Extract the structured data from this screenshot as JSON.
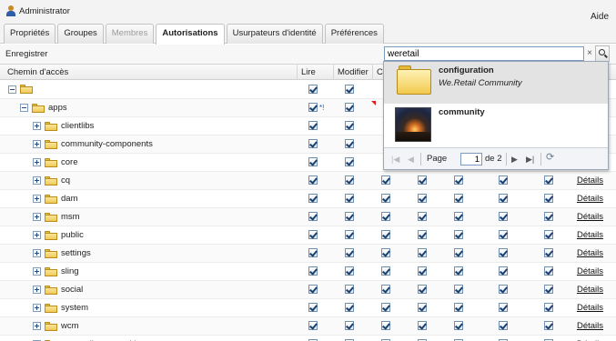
{
  "header": {
    "user": "Administrator",
    "help": "Aide"
  },
  "tabs": [
    {
      "label": "Propriétés",
      "state": "normal"
    },
    {
      "label": "Groupes",
      "state": "normal"
    },
    {
      "label": "Membres",
      "state": "disabled"
    },
    {
      "label": "Autorisations",
      "state": "active"
    },
    {
      "label": "Usurpateurs d'identité",
      "state": "normal"
    },
    {
      "label": "Préférences",
      "state": "normal"
    }
  ],
  "toolbar": {
    "save": "Enregistrer"
  },
  "search": {
    "value": "weretail",
    "clear": "×"
  },
  "columns": {
    "path": "Chemin d'accès",
    "read": "Lire",
    "modify": "Modifier",
    "create": "Cr"
  },
  "tree": {
    "root_label": "",
    "apps": {
      "label": "apps",
      "marker": "*!"
    },
    "children": [
      {
        "label": "clientlibs",
        "details": ""
      },
      {
        "label": "community-components",
        "details": ""
      },
      {
        "label": "core",
        "details": ""
      },
      {
        "label": "cq",
        "details": "Détails"
      },
      {
        "label": "dam",
        "details": "Détails"
      },
      {
        "label": "msm",
        "details": "Détails"
      },
      {
        "label": "public",
        "details": "Détails"
      },
      {
        "label": "settings",
        "details": "Détails"
      },
      {
        "label": "sling",
        "details": "Détails"
      },
      {
        "label": "social",
        "details": "Détails"
      },
      {
        "label": "system",
        "details": "Détails"
      },
      {
        "label": "wcm",
        "details": "Détails"
      },
      {
        "label": "we-retail-communities",
        "details": "Détails"
      }
    ]
  },
  "results": [
    {
      "title": "configuration",
      "subtitle": "We.Retail Community",
      "icon": "folder-icon"
    },
    {
      "title": "community",
      "subtitle": "",
      "icon": "campfire-thumbnail"
    }
  ],
  "pager": {
    "page_label": "Page",
    "page_value": "1",
    "of_label": "de 2"
  }
}
